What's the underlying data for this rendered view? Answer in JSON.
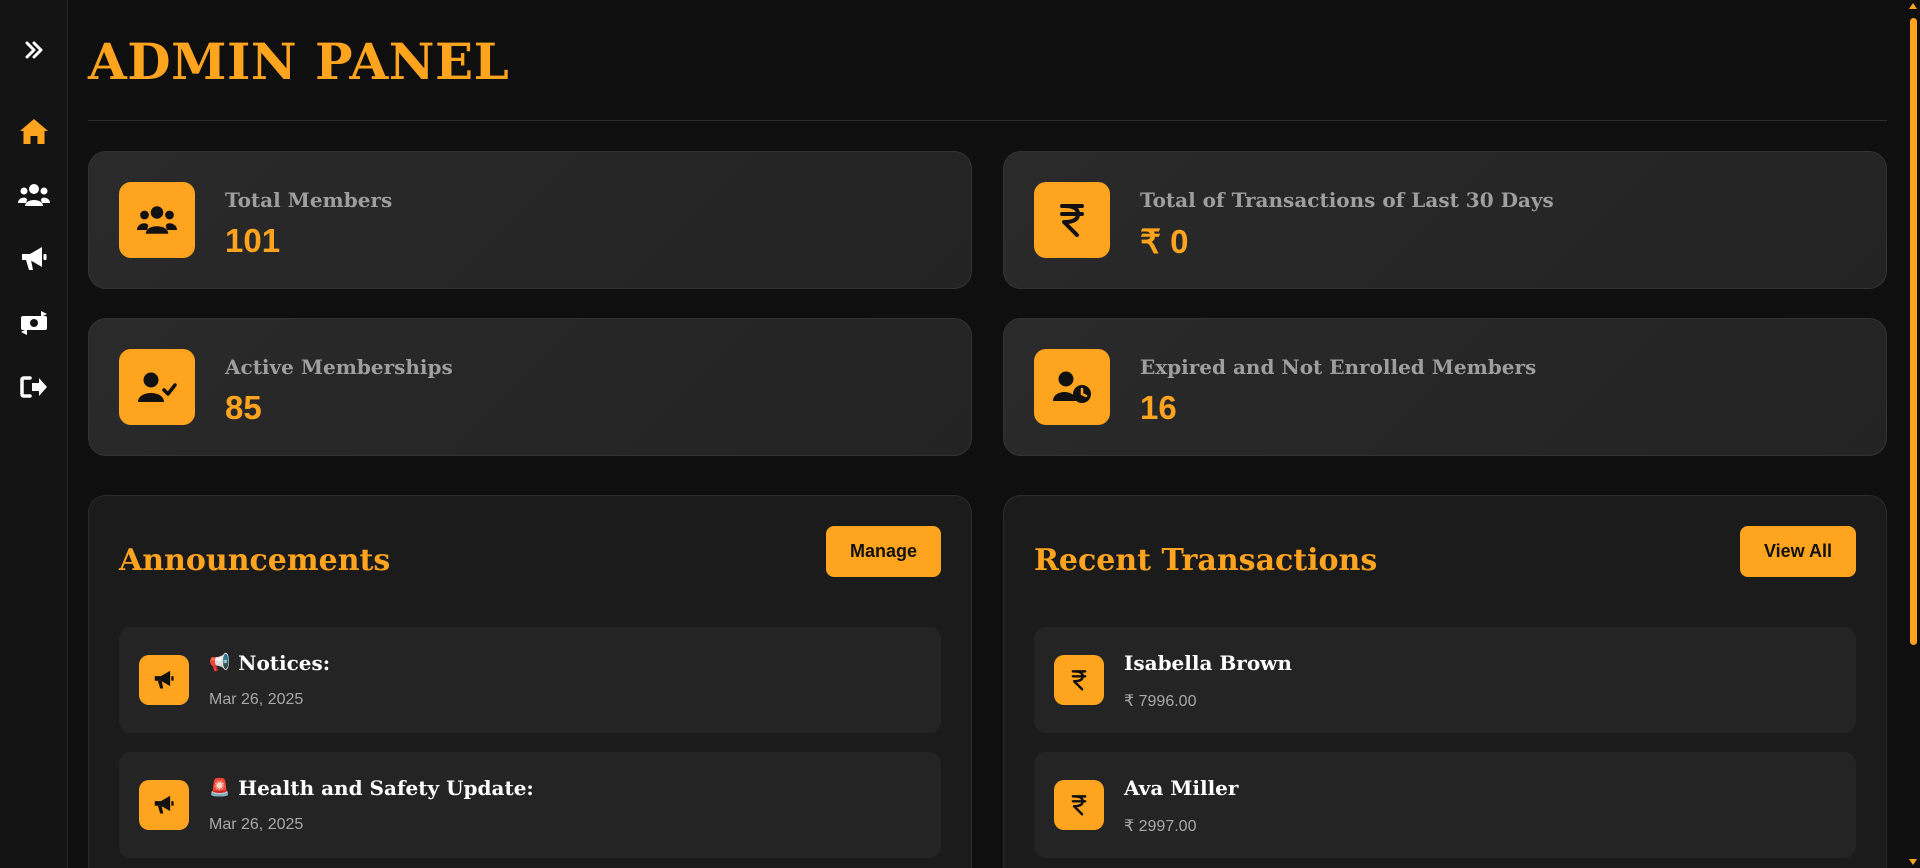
{
  "colors": {
    "accent": "#ffa41f",
    "background": "#0f0f0f",
    "card": "#262626",
    "text_muted": "#9e9e9e"
  },
  "sidebar": {
    "toggle_icon": "double-chevron-right-icon",
    "items": [
      {
        "name": "home",
        "icon": "home-icon",
        "active": true
      },
      {
        "name": "members",
        "icon": "users-icon",
        "active": false
      },
      {
        "name": "announcements",
        "icon": "bullhorn-icon",
        "active": false
      },
      {
        "name": "transactions",
        "icon": "money-exchange-icon",
        "active": false
      },
      {
        "name": "logout",
        "icon": "sign-out-icon",
        "active": false
      }
    ]
  },
  "header": {
    "title": "ADMIN PANEL"
  },
  "stats": [
    {
      "label": "Total Members",
      "value": "101",
      "icon": "users-icon"
    },
    {
      "label": "Total of Transactions of Last 30 Days",
      "value": "₹ 0",
      "icon": "rupee-icon"
    },
    {
      "label": "Active Memberships",
      "value": "85",
      "icon": "user-check-icon"
    },
    {
      "label": "Expired and Not Enrolled Members",
      "value": "16",
      "icon": "user-clock-icon"
    }
  ],
  "announcements": {
    "title": "Announcements",
    "button_label": "Manage",
    "items": [
      {
        "emoji": "📢",
        "title": "Notices:",
        "date": "Mar 26, 2025",
        "icon": "bullhorn-icon"
      },
      {
        "emoji": "🚨",
        "title": "Health and Safety Update:",
        "date": "Mar 26, 2025",
        "icon": "bullhorn-icon"
      }
    ]
  },
  "transactions": {
    "title": "Recent Transactions",
    "button_label": "View All",
    "items": [
      {
        "name": "Isabella Brown",
        "amount": "₹ 7996.00",
        "icon": "rupee-icon"
      },
      {
        "name": "Ava Miller",
        "amount": "₹ 2997.00",
        "icon": "rupee-icon"
      }
    ]
  }
}
